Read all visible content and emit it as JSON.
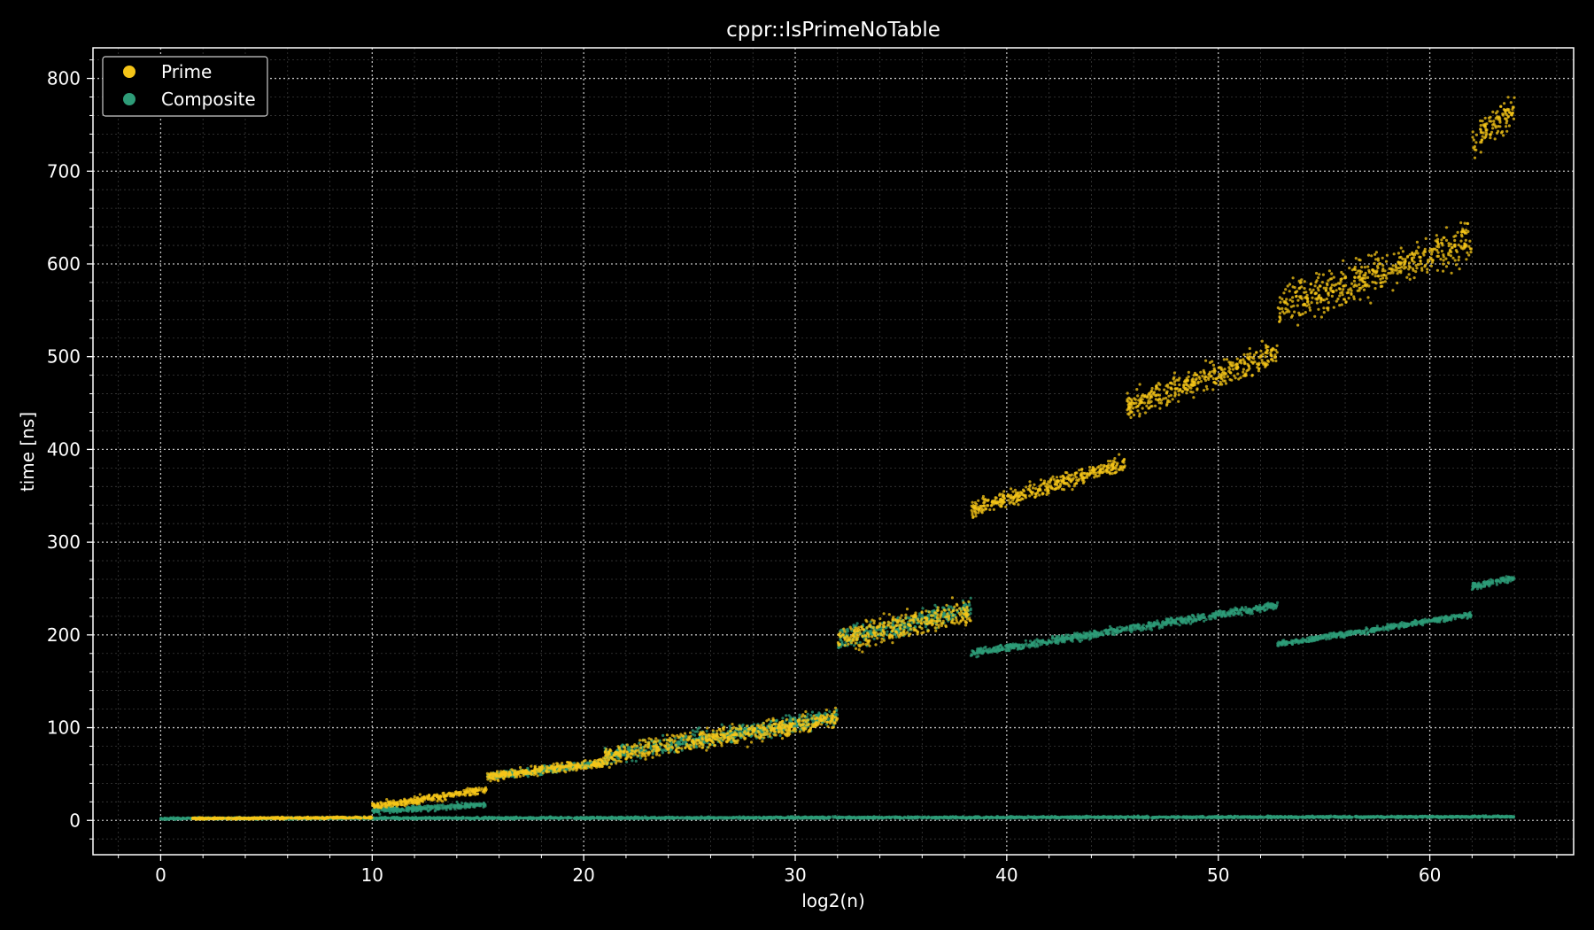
{
  "chart_data": {
    "type": "scatter",
    "title": "cppr::IsPrimeNoTable",
    "xlabel": "log2(n)",
    "ylabel": "time [ns]",
    "xlim": [
      -3.2,
      66.8
    ],
    "ylim": [
      -37,
      833
    ],
    "xticks": [
      0,
      10,
      20,
      30,
      40,
      50,
      60
    ],
    "yticks": [
      0,
      100,
      200,
      300,
      400,
      500,
      600,
      700,
      800
    ],
    "grid": true,
    "minor_grid": true,
    "legend_position": "top-left",
    "background": "#000000",
    "series": [
      {
        "name": "Prime",
        "color": "#f5c518",
        "clusters": [
          {
            "x_range": [
              1.5,
              10
            ],
            "y_range": [
              2,
              3
            ],
            "spread": 1
          },
          {
            "x_range": [
              10,
              15.4
            ],
            "y_range": [
              15,
              33
            ],
            "spread": 4
          },
          {
            "x_range": [
              15.4,
              21
            ],
            "y_range": [
              47,
              63
            ],
            "spread": 5
          },
          {
            "x_range": [
              21,
              32
            ],
            "y_range": [
              70,
              110
            ],
            "spread": 10
          },
          {
            "x_range": [
              32,
              38.3
            ],
            "y_range": [
              195,
              225
            ],
            "spread": 14
          },
          {
            "x_range": [
              38.3,
              45.6
            ],
            "y_range": [
              335,
              385
            ],
            "spread": 8
          },
          {
            "x_range": [
              45.6,
              52.8
            ],
            "y_range": [
              445,
              505
            ],
            "spread": 14
          },
          {
            "x_range": [
              52.8,
              62
            ],
            "y_range": [
              555,
              625
            ],
            "spread": 22
          },
          {
            "x_range": [
              62,
              64
            ],
            "y_range": [
              730,
              765
            ],
            "spread": 20
          }
        ]
      },
      {
        "name": "Composite",
        "color": "#2e9c78",
        "clusters": [
          {
            "x_range": [
              0,
              64
            ],
            "y_range": [
              2,
              4
            ],
            "spread": 1
          },
          {
            "x_range": [
              10,
              15.4
            ],
            "y_range": [
              10,
              17
            ],
            "spread": 3
          },
          {
            "x_range": [
              15.4,
              21
            ],
            "y_range": [
              47,
              62
            ],
            "spread": 4
          },
          {
            "x_range": [
              21,
              32
            ],
            "y_range": [
              70,
              112
            ],
            "spread": 9
          },
          {
            "x_range": [
              32,
              38.3
            ],
            "y_range": [
              195,
              228
            ],
            "spread": 11
          },
          {
            "x_range": [
              38.3,
              52.8
            ],
            "y_range": [
              180,
              232
            ],
            "spread": 4
          },
          {
            "x_range": [
              52.8,
              62
            ],
            "y_range": [
              190,
              222
            ],
            "spread": 3
          },
          {
            "x_range": [
              62,
              64
            ],
            "y_range": [
              252,
              262
            ],
            "spread": 4
          }
        ]
      }
    ]
  }
}
